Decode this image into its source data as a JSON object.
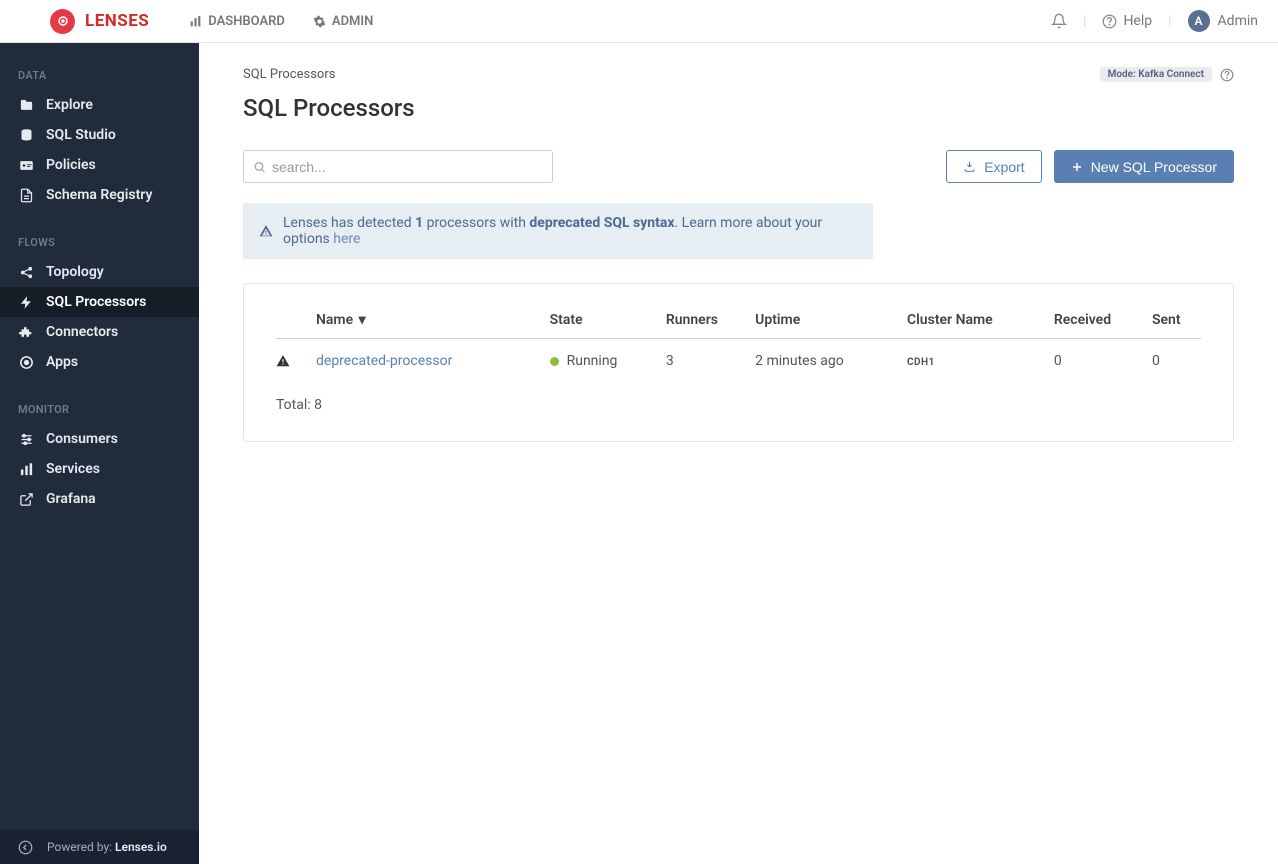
{
  "header": {
    "brand": "LENSES",
    "nav": {
      "dashboard": "DASHBOARD",
      "admin": "ADMIN"
    },
    "help": "Help",
    "user_name": "Admin",
    "user_initial": "A"
  },
  "sidebar": {
    "sections": {
      "data": {
        "label": "DATA",
        "items": {
          "explore": "Explore",
          "sql_studio": "SQL Studio",
          "policies": "Policies",
          "schema_registry": "Schema Registry"
        }
      },
      "flows": {
        "label": "FLOWS",
        "items": {
          "topology": "Topology",
          "sql_processors": "SQL Processors",
          "connectors": "Connectors",
          "apps": "Apps"
        }
      },
      "monitor": {
        "label": "MONITOR",
        "items": {
          "consumers": "Consumers",
          "services": "Services",
          "grafana": "Grafana"
        }
      }
    },
    "footer": {
      "powered_by_label": "Powered by: ",
      "powered_by_value": "Lenses.io"
    }
  },
  "main": {
    "breadcrumb": "SQL Processors",
    "mode_badge": "Mode: Kafka Connect",
    "page_title": "SQL Processors",
    "search_placeholder": "search...",
    "buttons": {
      "export": "Export",
      "new_processor": "New SQL Processor"
    },
    "alert": {
      "prefix": "Lenses has detected ",
      "count": "1",
      "mid": " processors with ",
      "strong": "deprecated SQL syntax",
      "suffix": ". Learn more about your options ",
      "link": "here"
    },
    "table": {
      "headers": {
        "name": "Name",
        "state": "State",
        "runners": "Runners",
        "uptime": "Uptime",
        "cluster": "Cluster Name",
        "received": "Received",
        "sent": "Sent"
      },
      "rows": [
        {
          "name": "deprecated-processor",
          "state": "Running",
          "runners": "3",
          "uptime": "2 minutes ago",
          "cluster": "CDH1",
          "received": "0",
          "sent": "0"
        }
      ],
      "total_label": "Total: ",
      "total_value": "8"
    }
  }
}
